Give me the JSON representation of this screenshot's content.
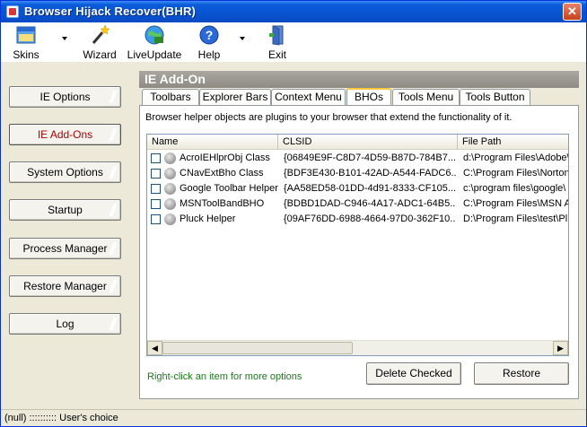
{
  "window": {
    "title": "Browser Hijack Recover(BHR)",
    "close_glyph": "✕"
  },
  "toolbar": {
    "items": [
      {
        "label": "Skins",
        "icon": "skins-icon"
      },
      {
        "label": "Wizard",
        "icon": "wizard-icon"
      },
      {
        "label": "LiveUpdate",
        "icon": "liveupdate-icon"
      },
      {
        "label": "Help",
        "icon": "help-icon"
      },
      {
        "label": "Exit",
        "icon": "exit-icon"
      }
    ]
  },
  "sidebar": {
    "items": [
      {
        "label": "IE Options",
        "active": false
      },
      {
        "label": "IE Add-Ons",
        "active": true
      },
      {
        "label": "System Options",
        "active": false
      },
      {
        "label": "Startup",
        "active": false
      },
      {
        "label": "Process Manager",
        "active": false
      },
      {
        "label": "Restore Manager",
        "active": false
      },
      {
        "label": "Log",
        "active": false
      }
    ],
    "active_color": "#b00000"
  },
  "main": {
    "title": "IE Add-On",
    "tabs": [
      {
        "label": "Toolbars"
      },
      {
        "label": "Explorer Bars"
      },
      {
        "label": "Context Menu"
      },
      {
        "label": "BHOs"
      },
      {
        "label": "Tools Menu"
      },
      {
        "label": "Tools Button"
      }
    ],
    "active_tab": "BHOs",
    "description": "Browser helper objects are plugins to your browser that extend the functionality of it.",
    "columns": [
      "Name",
      "CLSID",
      "File Path"
    ],
    "rows": [
      {
        "name": "AcroIEHlprObj Class",
        "clsid": "{06849E9F-C8D7-4D59-B87D-784B7...",
        "path": "d:\\Program Files\\Adobe\\"
      },
      {
        "name": "CNavExtBho Class",
        "clsid": "{BDF3E430-B101-42AD-A544-FADC6...",
        "path": "C:\\Program Files\\Norton"
      },
      {
        "name": "Google Toolbar Helper",
        "clsid": "{AA58ED58-01DD-4d91-8333-CF105...",
        "path": "c:\\program files\\google\\"
      },
      {
        "name": "MSNToolBandBHO",
        "clsid": "{BDBD1DAD-C946-4A17-ADC1-64B5...",
        "path": "C:\\Program Files\\MSN A"
      },
      {
        "name": "Pluck Helper",
        "clsid": "{09AF76DD-6988-4664-97D0-362F10...",
        "path": "D:\\Program Files\\test\\Pl"
      }
    ],
    "hint": "Right-click an item for more options",
    "delete_label": "Delete Checked",
    "restore_label": "Restore",
    "hint_color": "#1b7a1b"
  },
  "statusbar": {
    "text": "(null) :::::::::: User's choice"
  }
}
